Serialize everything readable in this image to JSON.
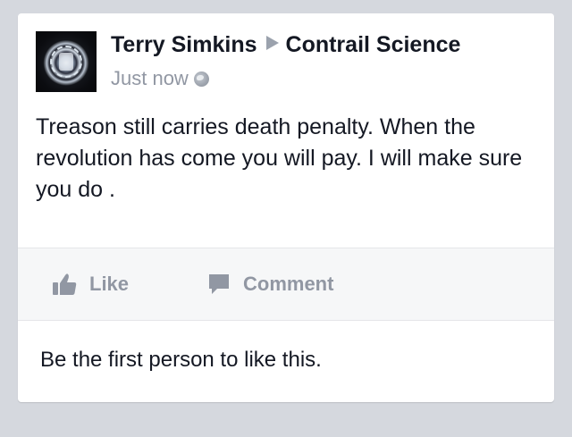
{
  "post": {
    "author": "Terry Simkins",
    "target": "Contrail Science",
    "timestamp": "Just now",
    "privacy_icon": "globe-icon",
    "body": "Treason still carries death penalty. When the revolution has come you will pay. I will make sure you do ."
  },
  "actions": {
    "like_label": "Like",
    "comment_label": "Comment"
  },
  "footer": {
    "likes_text": "Be the first person to like this."
  },
  "colors": {
    "background": "#d5d8de",
    "text": "#141823",
    "muted": "#9197a3",
    "action_bar": "#f6f7f8"
  }
}
